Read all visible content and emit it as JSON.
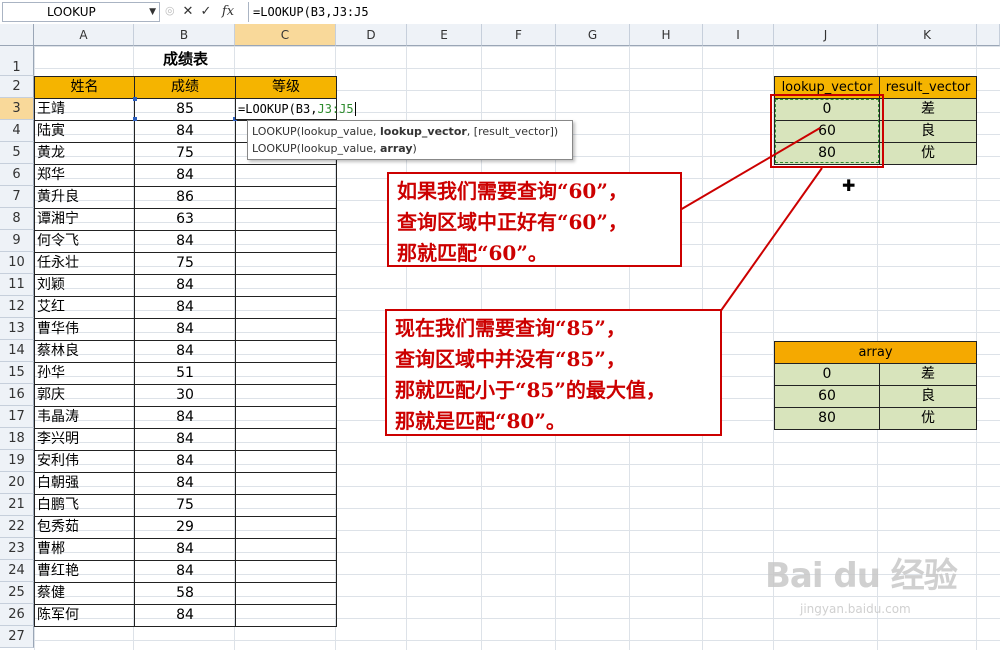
{
  "formula_bar": {
    "name_box": "LOOKUP",
    "cancel_icon": "✕",
    "enter_icon": "✓",
    "fx_label": "fx",
    "formula": "=LOOKUP(B3,J3:J5"
  },
  "columns": [
    "A",
    "B",
    "C",
    "D",
    "E",
    "F",
    "G",
    "H",
    "I",
    "J",
    "K"
  ],
  "rows": [
    "1",
    "2",
    "3",
    "4",
    "5",
    "6",
    "7",
    "8",
    "9",
    "10",
    "11",
    "12",
    "13",
    "14",
    "15",
    "16",
    "17",
    "18",
    "19",
    "20",
    "21",
    "22",
    "23",
    "24",
    "25",
    "26",
    "27"
  ],
  "sheet": {
    "title": "成绩表",
    "headers": {
      "name": "姓名",
      "score": "成绩",
      "grade": "等级"
    },
    "edit_cell": {
      "prefix": "=LOOKUP(B3,",
      "ref": "J3:J5"
    },
    "students": [
      {
        "name": "王靖",
        "score": "85"
      },
      {
        "name": "陆寅",
        "score": "84"
      },
      {
        "name": "黄龙",
        "score": "75"
      },
      {
        "name": "郑华",
        "score": "84"
      },
      {
        "name": "黄升良",
        "score": "86"
      },
      {
        "name": "谭湘宁",
        "score": "63"
      },
      {
        "name": "何令飞",
        "score": "84"
      },
      {
        "name": "任永壮",
        "score": "75"
      },
      {
        "name": "刘颖",
        "score": "84"
      },
      {
        "name": "艾红",
        "score": "84"
      },
      {
        "name": "曹华伟",
        "score": "84"
      },
      {
        "name": "蔡林良",
        "score": "84"
      },
      {
        "name": "孙华",
        "score": "51"
      },
      {
        "name": "郭庆",
        "score": "30"
      },
      {
        "name": "韦晶涛",
        "score": "84"
      },
      {
        "name": "李兴明",
        "score": "84"
      },
      {
        "name": "安利伟",
        "score": "84"
      },
      {
        "name": "白朝强",
        "score": "84"
      },
      {
        "name": "白鹏飞",
        "score": "75"
      },
      {
        "name": "包秀茹",
        "score": "29"
      },
      {
        "name": "曹郴",
        "score": "84"
      },
      {
        "name": "曹红艳",
        "score": "84"
      },
      {
        "name": "蔡健",
        "score": "58"
      },
      {
        "name": "陈军何",
        "score": "84"
      }
    ]
  },
  "tooltip": {
    "line1_a": "LOOKUP(lookup_value, ",
    "line1_b": "lookup_vector",
    "line1_c": ", [result_vector])",
    "line2_a": "LOOKUP(lookup_value, ",
    "line2_b": "array",
    "line2_c": ")"
  },
  "vector_table": {
    "header_lookup": "lookup_vector",
    "header_result": "result_vector",
    "rows": [
      {
        "lookup": "0",
        "result": "差"
      },
      {
        "lookup": "60",
        "result": "良"
      },
      {
        "lookup": "80",
        "result": "优"
      }
    ]
  },
  "array_table": {
    "header": "array",
    "rows": [
      {
        "lookup": "0",
        "result": "差"
      },
      {
        "lookup": "60",
        "result": "良"
      },
      {
        "lookup": "80",
        "result": "优"
      }
    ]
  },
  "callout1": [
    "如果我们需要查询“60”，",
    "查询区域中正好有“60”，",
    "那就匹配“60”。"
  ],
  "callout2": [
    "现在我们需要查询“85”，",
    "查询区域中并没有“85”，",
    "那就匹配小于“85”的最大值，",
    "那就是匹配“80”。"
  ],
  "watermark": {
    "brand": "Bai du 经验",
    "url": "jingyan.baidu.com"
  },
  "colors": {
    "header_orange": "#f5b400",
    "green_fill": "#d8e4bc",
    "callout_red": "#cc0000",
    "selected_header": "#f9d99a"
  }
}
